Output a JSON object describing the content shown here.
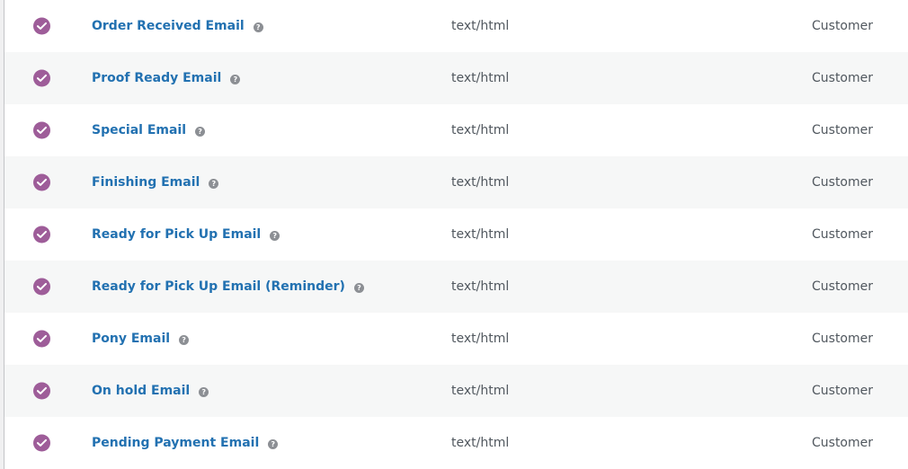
{
  "colors": {
    "enabled_icon": "#9e5d99",
    "link": "#2271b1",
    "text": "#50575e",
    "row_alt": "#f6f7f7"
  },
  "icons": {
    "status": "check-circle-icon",
    "help": "help-icon"
  },
  "help_glyph": "?",
  "rows": [
    {
      "name": "Order Received Email",
      "type": "text/html",
      "recipient": "Customer"
    },
    {
      "name": "Proof Ready Email",
      "type": "text/html",
      "recipient": "Customer"
    },
    {
      "name": "Special Email",
      "type": "text/html",
      "recipient": "Customer"
    },
    {
      "name": "Finishing Email",
      "type": "text/html",
      "recipient": "Customer"
    },
    {
      "name": "Ready for Pick Up Email",
      "type": "text/html",
      "recipient": "Customer"
    },
    {
      "name": "Ready for Pick Up Email (Reminder)",
      "type": "text/html",
      "recipient": "Customer"
    },
    {
      "name": "Pony Email",
      "type": "text/html",
      "recipient": "Customer"
    },
    {
      "name": "On hold Email",
      "type": "text/html",
      "recipient": "Customer"
    },
    {
      "name": "Pending Payment Email",
      "type": "text/html",
      "recipient": "Customer"
    }
  ]
}
